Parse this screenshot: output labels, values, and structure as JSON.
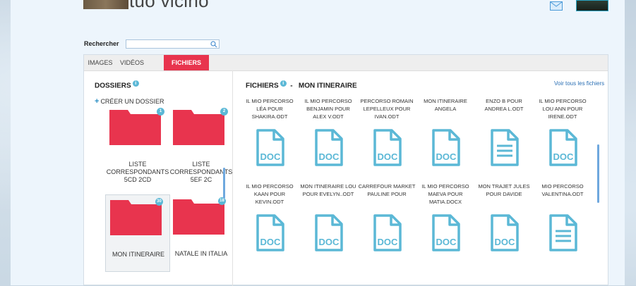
{
  "header": {
    "title": "tuo vicino"
  },
  "search": {
    "label": "Rechercher",
    "value": "",
    "placeholder": ""
  },
  "tabs": [
    {
      "label": "IMAGES",
      "active": false
    },
    {
      "label": "VIDÉOS",
      "active": false
    },
    {
      "label": "FICHIERS",
      "active": true
    }
  ],
  "folders": {
    "title": "DOSSIERS",
    "info": "i",
    "create_label": "CRÉER UN DOSSIER",
    "items": [
      {
        "name": "LISTE CORRESPONDANTS 5CD 2CD",
        "count": "1",
        "selected": false
      },
      {
        "name": "LISTE CORRESPONDANTS 5EF 2C",
        "count": "2",
        "selected": false
      },
      {
        "name": "MON ITINERAIRE",
        "count": "30",
        "selected": true
      },
      {
        "name": "NATALE IN ITALIA",
        "count": "18",
        "selected": false
      }
    ]
  },
  "files": {
    "title": "FICHIERS",
    "info": "i",
    "separator": "-",
    "folder_name": "MON ITINERAIRE",
    "view_all_label": "Voir tous les fichiers",
    "doc_label": "DOC",
    "items": [
      {
        "name": "IL MIO PERCORSO LÉA POUR SHAKIRA.ODT",
        "icon": "doc-file-icon"
      },
      {
        "name": "IL MIO PERCORSO BENJAMIN POUR ALEX V.ODT",
        "icon": "doc-file-icon"
      },
      {
        "name": "PERCORSO ROMAIN LEPELLEUX POUR IVAN.ODT",
        "icon": "doc-file-icon"
      },
      {
        "name": "MON ITINERAIRE ANGELA",
        "icon": "doc-file-icon"
      },
      {
        "name": "ENZO B POUR ANDREA L.ODT",
        "icon": "text-file-icon"
      },
      {
        "name": "IL MIO PERCORSO LOU ANN POUR IRENE.ODT",
        "icon": "doc-file-icon"
      },
      {
        "name": "IL MIO PERCORSO KAAN POUR KEVIN.ODT",
        "icon": "doc-file-icon"
      },
      {
        "name": "MON ITINERAIRE LOU POUR EVELYN..ODT",
        "icon": "doc-file-icon"
      },
      {
        "name": "CARREFOUR MARKET PAULINE POUR",
        "icon": "doc-file-icon"
      },
      {
        "name": "IL MIO PERCORSO MAEVA POUR MATIA.DOCX",
        "icon": "doc-file-icon"
      },
      {
        "name": "MON TRAJET JULES POUR DAVIDE",
        "icon": "doc-file-icon"
      },
      {
        "name": "MIO PERCORSO VALENTINA.ODT",
        "icon": "text-file-icon"
      }
    ]
  },
  "colors": {
    "accent": "#e8344e",
    "file_icon": "#5bb8d6",
    "link": "#2a6fb4"
  }
}
